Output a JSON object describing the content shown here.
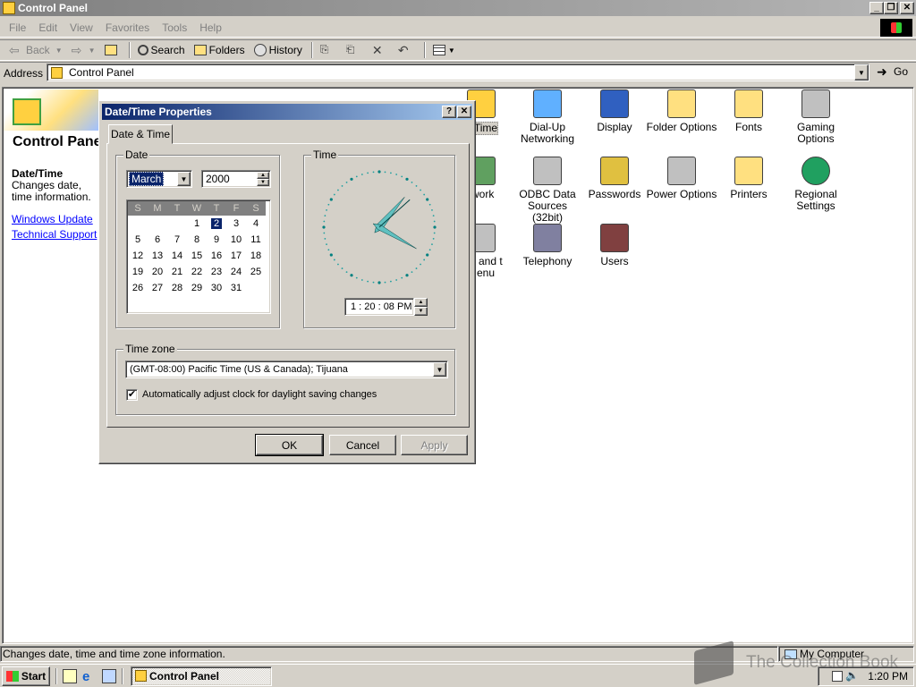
{
  "window": {
    "title": "Control Panel"
  },
  "menu": [
    "File",
    "Edit",
    "View",
    "Favorites",
    "Tools",
    "Help"
  ],
  "toolbar": {
    "back": "Back",
    "search": "Search",
    "folders": "Folders",
    "history": "History"
  },
  "address": {
    "label": "Address",
    "value": "Control Panel",
    "go": "Go"
  },
  "left_panel": {
    "heading": "Control Panel",
    "item_title": "Date/Time",
    "item_desc": "Changes date, time information.",
    "links": [
      "Windows Update",
      "Technical Support"
    ]
  },
  "icons": [
    {
      "label": "Date/Time",
      "partial": "e/Time"
    },
    {
      "label": "Dial-Up Networking"
    },
    {
      "label": "Display"
    },
    {
      "label": "Folder Options"
    },
    {
      "label": "Fonts"
    },
    {
      "label": "Gaming Options"
    },
    {
      "label": "Network",
      "partial": "twork"
    },
    {
      "label": "ODBC Data Sources (32bit)"
    },
    {
      "label": "Passwords"
    },
    {
      "label": "Power Options"
    },
    {
      "label": "Printers"
    },
    {
      "label": "Regional Settings"
    },
    {
      "label": "Taskbar and Start Menu",
      "partial": "bar and t Menu"
    },
    {
      "label": "Telephony"
    },
    {
      "label": "Users"
    }
  ],
  "dialog": {
    "title": "Date/Time Properties",
    "tab": "Date & Time",
    "date_group": "Date",
    "month": "March",
    "year": "2000",
    "weekdays": [
      "S",
      "M",
      "T",
      "W",
      "T",
      "F",
      "S"
    ],
    "weeks": [
      [
        "",
        "",
        "",
        "1",
        "2",
        "3",
        "4"
      ],
      [
        "5",
        "6",
        "7",
        "8",
        "9",
        "10",
        "11"
      ],
      [
        "12",
        "13",
        "14",
        "15",
        "16",
        "17",
        "18"
      ],
      [
        "19",
        "20",
        "21",
        "22",
        "23",
        "24",
        "25"
      ],
      [
        "26",
        "27",
        "28",
        "29",
        "30",
        "31",
        ""
      ]
    ],
    "selected_day": "2",
    "time_group": "Time",
    "time": "1 : 20 : 08 PM",
    "timezone_group": "Time zone",
    "timezone": "(GMT-08:00) Pacific Time (US & Canada); Tijuana",
    "dst_label": "Automatically adjust clock for daylight saving changes",
    "dst_checked": true,
    "ok": "OK",
    "cancel": "Cancel",
    "apply": "Apply"
  },
  "status": {
    "text": "Changes date, time and time zone information.",
    "zone": "My Computer"
  },
  "taskbar": {
    "start": "Start",
    "task": "Control Panel",
    "clock": "1:20 PM"
  },
  "watermark": "The Collection Book",
  "colors": {
    "titlebar_active": "#0a246a",
    "titlebar_inactive": "#808080",
    "face": "#d4d0c8",
    "link": "#0000ff"
  }
}
